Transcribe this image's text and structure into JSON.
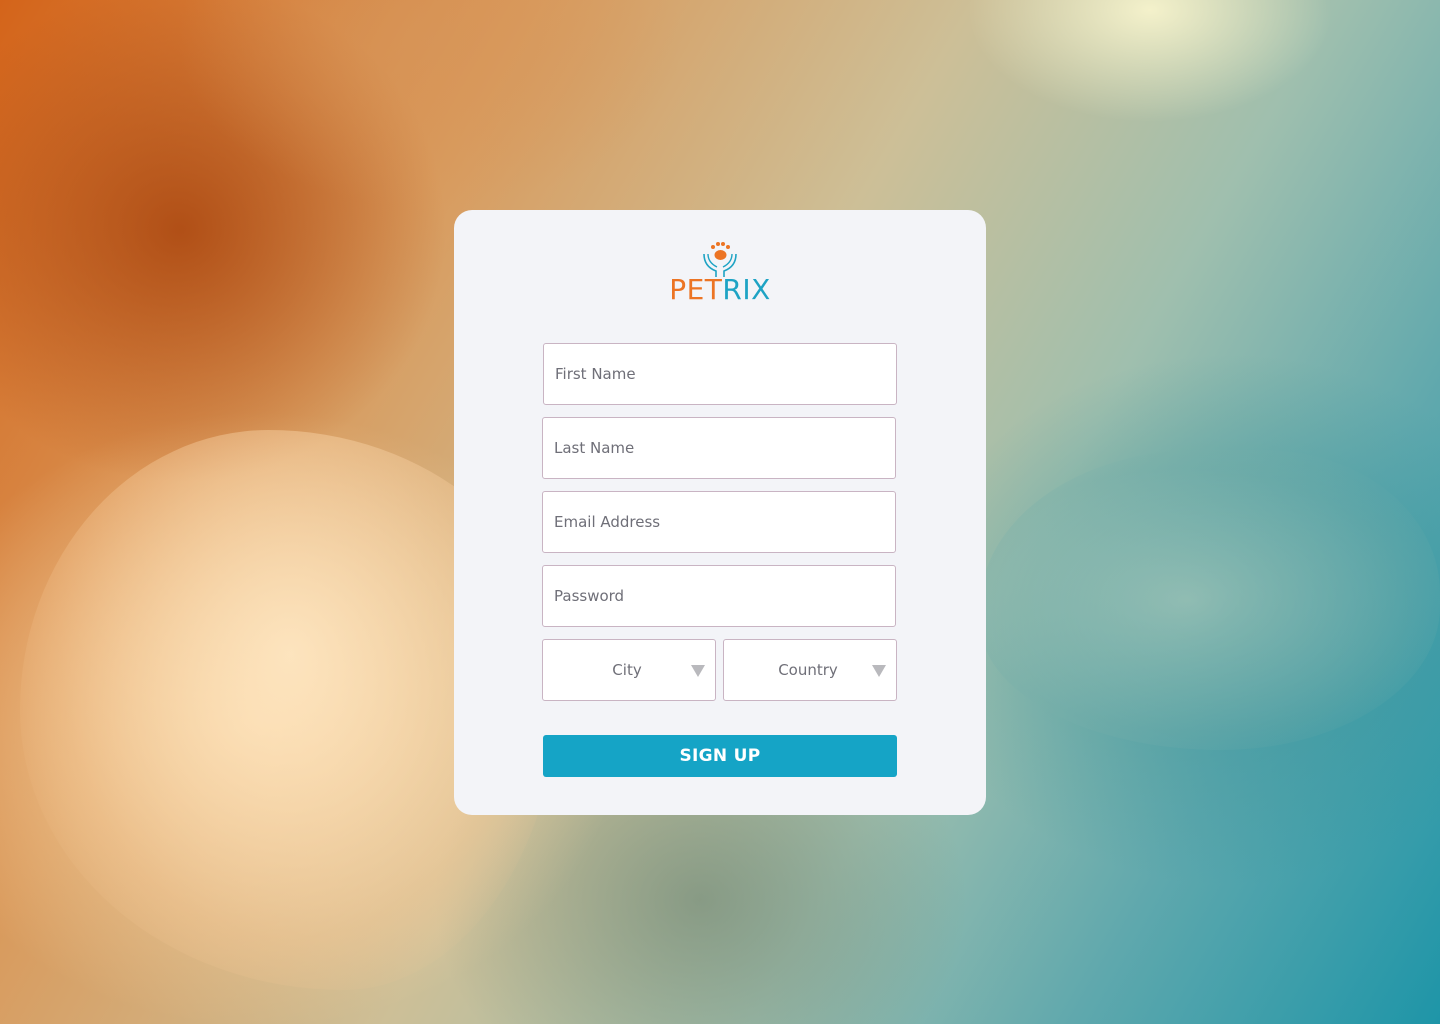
{
  "brand": {
    "name_part1": "PET",
    "name_part2": "RIX",
    "logo_icon": "paw-in-hands-icon",
    "color_orange": "#ec7424",
    "color_teal": "#1ea3c4"
  },
  "form": {
    "first_name_placeholder": "First Name",
    "last_name_placeholder": "Last Name",
    "email_placeholder": "Email Address",
    "password_placeholder": "Password",
    "city_label": "City",
    "country_label": "Country",
    "submit_label": "SIGN UP",
    "button_color": "#15a4c6"
  }
}
